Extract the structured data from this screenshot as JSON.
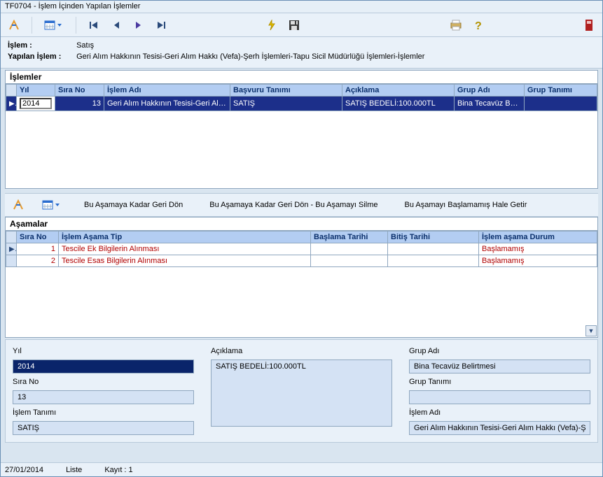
{
  "window": {
    "title": "TF0704 - İşlem İçinden Yapılan İşlemler"
  },
  "info": {
    "label_islem": "İşlem :",
    "islem": "Satış",
    "label_yapilan": "Yapılan İşlem :",
    "yapilan": "Geri Alım Hakkının Tesisi-Geri Alım Hakkı (Vefa)-Şerh İşlemleri-Tapu Sicil Müdürlüğü İşlemleri-İşlemler"
  },
  "grid1": {
    "title": "İşlemler",
    "headers": [
      "Yıl",
      "Sıra No",
      "İşlem Adı",
      "Başvuru Tanımı",
      "Açıklama",
      "Grup Adı",
      "Grup Tanımı"
    ],
    "row": {
      "yil": "2014",
      "sira_no": "13",
      "islem_adi": "Geri Alım Hakkının Tesisi-Geri Alım Ha",
      "basvuru": "SATIŞ",
      "aciklama": "SATIŞ BEDELİ:100.000TL",
      "grup_adi": "Bina Tecavüz Belirtm",
      "grup_tanimi": ""
    }
  },
  "toolbar2": {
    "btn1": "Bu Aşamaya Kadar Geri Dön",
    "btn2": "Bu Aşamaya Kadar Geri Dön - Bu Aşamayı Silme",
    "btn3": "Bu Aşamayı Başlamamış Hale Getir"
  },
  "grid2": {
    "title": "Aşamalar",
    "headers": [
      "Sıra No",
      "İşlem Aşama Tip",
      "Başlama Tarihi",
      "Bitiş Tarihi",
      "İşlem aşama Durum"
    ],
    "rows": [
      {
        "sira": "1",
        "tip": "Tescile Ek Bilgilerin Alınması",
        "baslama": "",
        "bitis": "",
        "durum": "Başlamamış"
      },
      {
        "sira": "2",
        "tip": "Tescile Esas Bilgilerin Alınması",
        "baslama": "",
        "bitis": "",
        "durum": "Başlamamış"
      }
    ]
  },
  "form": {
    "yil_label": "Yıl",
    "yil": "2014",
    "sira_label": "Sıra No",
    "sira": "13",
    "tanim_label": "İşlem Tanımı",
    "tanim": "SATIŞ",
    "aciklama_label": "Açıklama",
    "aciklama": "SATIŞ BEDELİ:100.000TL",
    "grup_adi_label": "Grup Adı",
    "grup_adi": "Bina Tecavüz Belirtmesi",
    "grup_tanimi_label": "Grup Tanımı",
    "grup_tanimi": "",
    "islem_adi_label": "İşlem Adı",
    "islem_adi": "Geri Alım Hakkının Tesisi-Geri Alım Hakkı (Vefa)-Şer"
  },
  "status": {
    "date": "27/01/2014",
    "mode": "Liste",
    "count_label": "Kayıt : 1"
  }
}
